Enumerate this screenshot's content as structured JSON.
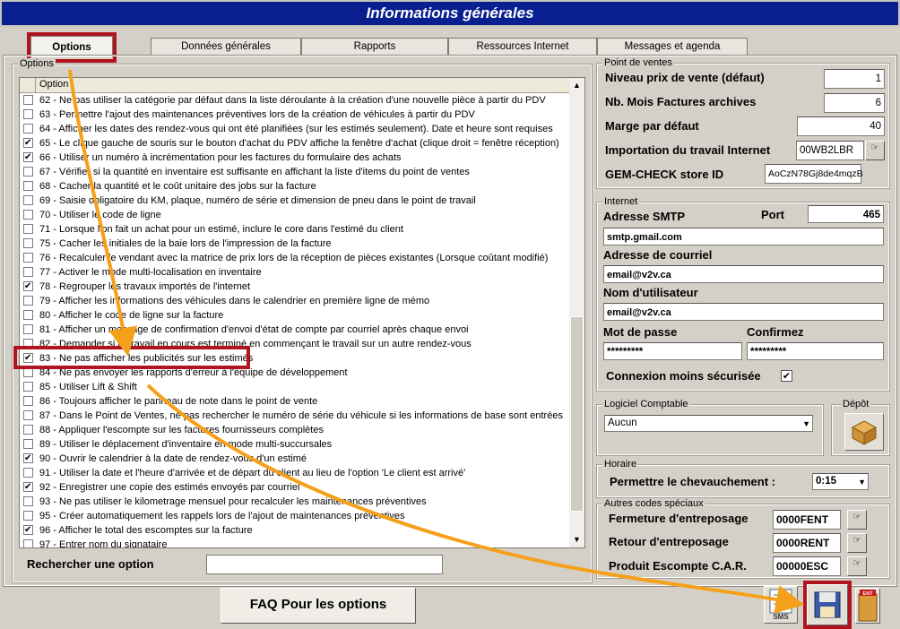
{
  "window": {
    "title": "Informations générales"
  },
  "tabs": [
    "Options",
    "Données générales",
    "Rapports",
    "Ressources Internet",
    "Messages et agenda"
  ],
  "options_group": {
    "label": "Options",
    "column_header": "Option",
    "items": [
      {
        "text": "62 - Ne pas utiliser la catégorie par défaut dans la liste déroulante à la création d'une nouvelle pièce à partir du PDV",
        "checked": false
      },
      {
        "text": "63 - Permettre l'ajout des maintenances préventives lors de la création de véhicules à partir du PDV",
        "checked": false
      },
      {
        "text": "64 - Afficher les dates des rendez-vous qui ont été planifiées (sur les estimés seulement). Date et heure sont requises",
        "checked": false
      },
      {
        "text": "65 - Le clique gauche de souris sur le bouton d'achat du PDV affiche la fenêtre d'achat (clique droit = fenêtre réception)",
        "checked": true
      },
      {
        "text": "66 - Utiliser un numéro à incrémentation pour les factures du formulaire des achats",
        "checked": true
      },
      {
        "text": "67 - Vérifier si la quantité en inventaire est suffisante en affichant la liste d'items du point de ventes",
        "checked": false
      },
      {
        "text": "68 - Cacher la quantité et le coût unitaire des jobs sur la facture",
        "checked": false
      },
      {
        "text": "69 - Saisie obligatoire du KM, plaque, numéro de série et dimension de pneu dans le point de travail",
        "checked": false
      },
      {
        "text": "70 - Utiliser le code de ligne",
        "checked": false
      },
      {
        "text": "71 - Lorsque l'on fait un achat pour un estimé, inclure le core dans l'estimé du client",
        "checked": false
      },
      {
        "text": "75 - Cacher les initiales de la baie lors de l'impression de la facture",
        "checked": false
      },
      {
        "text": "76 - Recalculer le vendant avec la matrice de prix lors de la réception de pièces existantes (Lorsque coûtant modifié)",
        "checked": false
      },
      {
        "text": "77 - Activer le mode multi-localisation en inventaire",
        "checked": false
      },
      {
        "text": "78 - Regrouper les travaux importés de l'internet",
        "checked": true
      },
      {
        "text": "79 - Afficher les informations des véhicules dans le calendrier en première ligne de mémo",
        "checked": false
      },
      {
        "text": "80 - Afficher le code de ligne sur la facture",
        "checked": false
      },
      {
        "text": "81 - Afficher un message de confirmation d'envoi d'état de compte par courriel après chaque envoi",
        "checked": false
      },
      {
        "text": "82 - Demander si le travail en cours est terminé en commençant le travail sur un autre rendez-vous",
        "checked": false
      },
      {
        "text": "83 - Ne pas afficher les publicités sur les estimés",
        "checked": true
      },
      {
        "text": "84 - Ne pas envoyer les rapports d'erreur à l'équipe de développement",
        "checked": false
      },
      {
        "text": "85 - Utiliser Lift & Shift",
        "checked": false
      },
      {
        "text": "86 - Toujours afficher le panneau de note dans le point de vente",
        "checked": false
      },
      {
        "text": "87 - Dans le Point de Ventes, ne pas rechercher le numéro de série du véhicule si les informations de base sont entrées",
        "checked": false
      },
      {
        "text": "88 - Appliquer l'escompte sur les factures fournisseurs complètes",
        "checked": false
      },
      {
        "text": "89 - Utiliser le déplacement d'inventaire en mode multi-succursales",
        "checked": false
      },
      {
        "text": "90 - Ouvrir le calendrier à la date de rendez-vous d'un estimé",
        "checked": true
      },
      {
        "text": "91 - Utiliser la date et l'heure d'arrivée et de départ du client au lieu de l'option 'Le client est arrivé'",
        "checked": false
      },
      {
        "text": "92 - Enregistrer une copie des estimés envoyés par courriel",
        "checked": true
      },
      {
        "text": "93 - Ne pas utiliser le kilometrage mensuel pour recalculer les maintenances préventives",
        "checked": false
      },
      {
        "text": "95 - Créer automatiquement les rappels lors de l'ajout de maintenances préventives",
        "checked": false
      },
      {
        "text": "96 - Afficher le total des escomptes sur la facture",
        "checked": true
      },
      {
        "text": "97 - Entrer nom du signataire",
        "checked": false
      }
    ],
    "search_label": "Rechercher une option",
    "search_value": ""
  },
  "point_de_ventes": {
    "label": "Point de ventes",
    "niveau_prix_label": "Niveau prix de vente (défaut)",
    "niveau_prix_value": "1",
    "nb_mois_label": "Nb. Mois Factures archives",
    "nb_mois_value": "6",
    "marge_label": "Marge par défaut",
    "marge_value": "40",
    "import_label": "Importation du travail Internet",
    "import_value": "00WB2LBR",
    "gemcheck_label": "GEM-CHECK store ID",
    "gemcheck_value": "AoCzN78Gj8de4mqzB"
  },
  "internet": {
    "label": "Internet",
    "smtp_label": "Adresse SMTP",
    "port_label": "Port",
    "port_value": "465",
    "smtp_value": "smtp.gmail.com",
    "email_label": "Adresse de courriel",
    "email_value": "email@v2v.ca",
    "user_label": "Nom d'utilisateur",
    "user_value": "email@v2v.ca",
    "pass_label": "Mot de passe",
    "pass_value": "*********",
    "confirm_label": "Confirmez",
    "confirm_value": "*********",
    "insecure_label": "Connexion moins sécurisée",
    "insecure_checked": true
  },
  "logiciel": {
    "label": "Logiciel Comptable",
    "value": "Aucun"
  },
  "depot": {
    "label": "Dépôt"
  },
  "horaire": {
    "label": "Horaire",
    "chevauchement_label": "Permettre le chevauchement :",
    "chevauchement_value": "0:15"
  },
  "autres": {
    "label": "Autres codes spéciaux",
    "fermeture_label": "Fermeture d'entreposage",
    "fermeture_value": "0000FENT",
    "retour_label": "Retour d'entreposage",
    "retour_value": "0000RENT",
    "escompte_label": "Produit Escompte C.A.R.",
    "escompte_value": "00000ESC"
  },
  "footer": {
    "faq_label": "FAQ Pour les options",
    "sms_label": "SMS",
    "exit_label": "EXIT"
  },
  "colors": {
    "title_bg": "#0a1f8f",
    "highlight": "#b0141e",
    "arrow": "#f5a01a"
  }
}
